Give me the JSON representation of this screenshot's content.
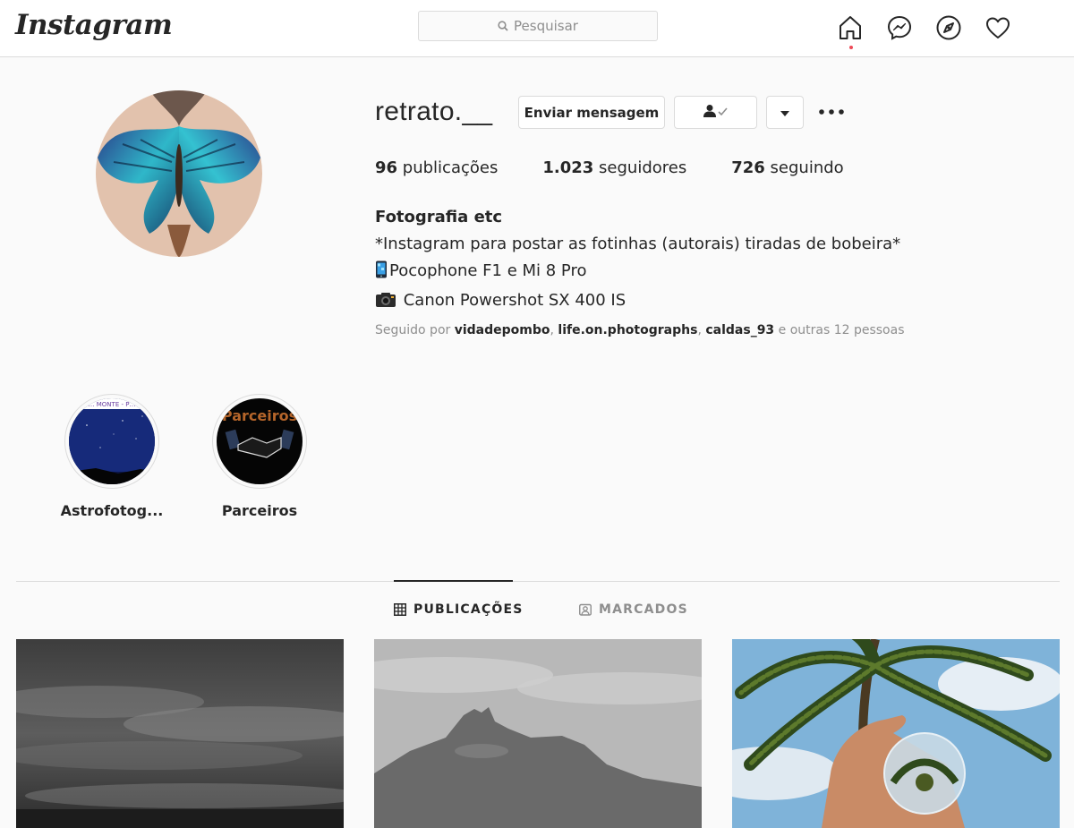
{
  "header": {
    "logo": "Instagram",
    "search_placeholder": "Pesquisar"
  },
  "profile": {
    "username": "retrato.__",
    "buttons": {
      "message": "Enviar mensagem"
    },
    "stats": {
      "posts_count": "96",
      "posts_label": "publicações",
      "followers_count": "1.023",
      "followers_label": "seguidores",
      "following_count": "726",
      "following_label": "seguindo"
    },
    "bio": {
      "full_name": "Fotografia etc",
      "line1": "*Instagram para postar as fotinhas (autorais) tiradas de bobeira*",
      "line2": "Pocophone F1 e Mi 8 Pro",
      "line3": " Canon Powershot SX 400 IS"
    },
    "followed_by": {
      "prefix": "Seguido por ",
      "user1": "vidadepombo",
      "sep1": ", ",
      "user2": "life.on.photographs",
      "sep2": ", ",
      "user3": "caldas_93",
      "suffix": " e outras 12 pessoas"
    }
  },
  "highlights": [
    {
      "label": "Astrofotog...",
      "cover_text": "… MONTE - P…"
    },
    {
      "label": "Parceiros",
      "cover_text": "Parceiros"
    }
  ],
  "tabs": [
    {
      "label": "PUBLICAÇÕES",
      "active": true
    },
    {
      "label": "MARCADOS",
      "active": false
    }
  ],
  "colors": {
    "notification_dot": "#ed4956",
    "border": "#dbdbdb",
    "secondary_text": "#8e8e8e"
  }
}
